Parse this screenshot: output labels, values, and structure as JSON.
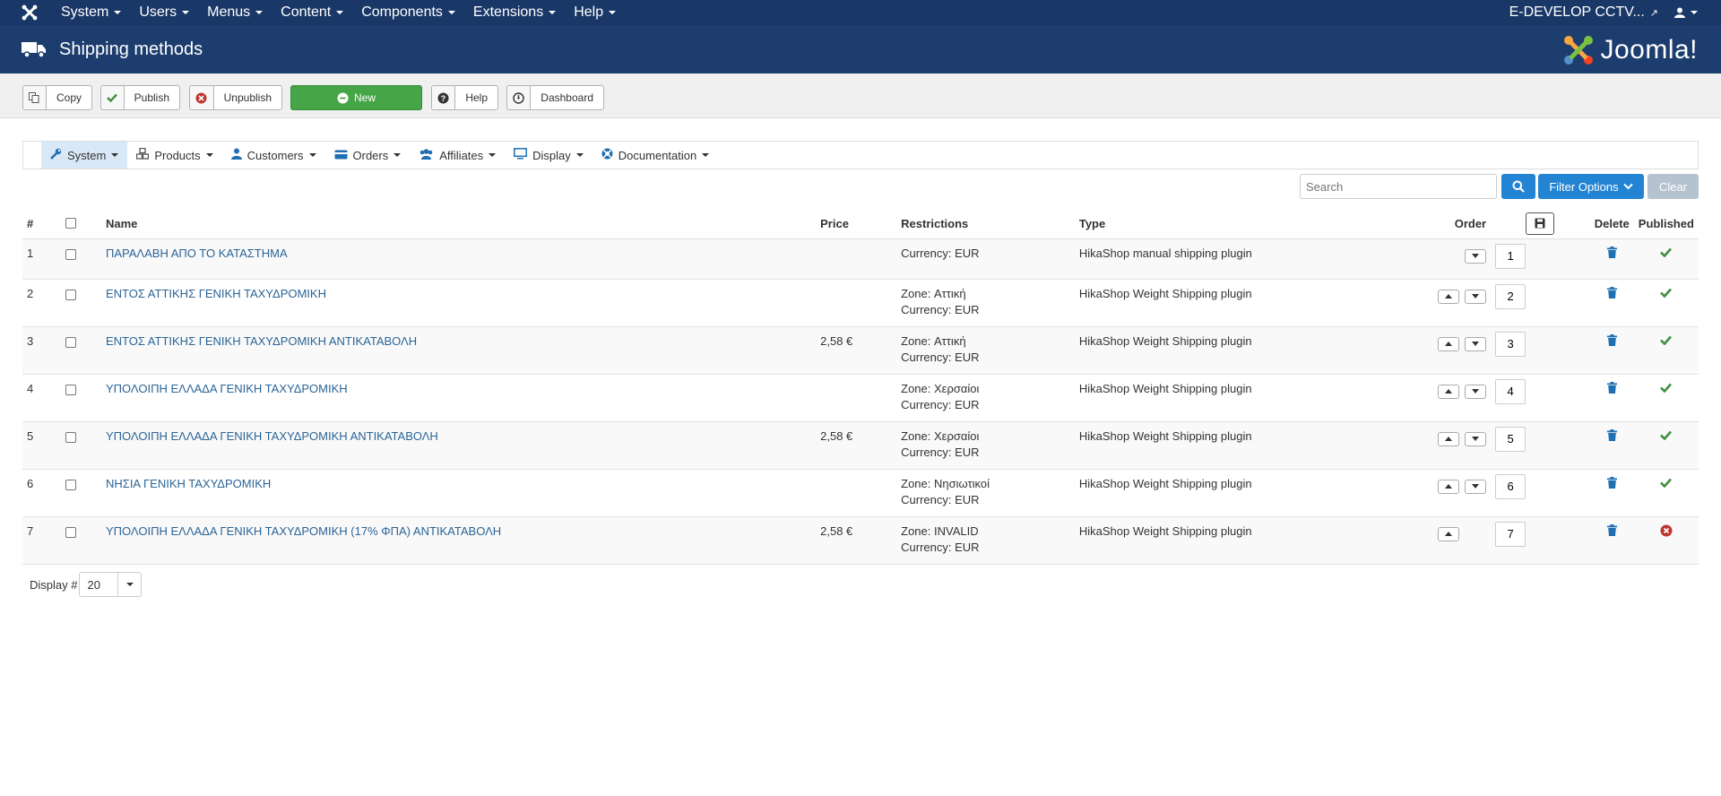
{
  "topbar": {
    "menu": [
      {
        "label": "System"
      },
      {
        "label": "Users"
      },
      {
        "label": "Menus"
      },
      {
        "label": "Content"
      },
      {
        "label": "Components"
      },
      {
        "label": "Extensions"
      },
      {
        "label": "Help"
      }
    ],
    "site_name": "E-DEVELOP CCTV..."
  },
  "header": {
    "title": "Shipping methods",
    "brand": "Joomla!"
  },
  "toolbar": {
    "copy": "Copy",
    "publish": "Publish",
    "unpublish": "Unpublish",
    "new": "New",
    "help": "Help",
    "dashboard": "Dashboard"
  },
  "submenu": [
    {
      "label": "System",
      "icon": "wrench-icon"
    },
    {
      "label": "Products",
      "icon": "cubes-icon"
    },
    {
      "label": "Customers",
      "icon": "user-icon"
    },
    {
      "label": "Orders",
      "icon": "credit-card-icon"
    },
    {
      "label": "Affiliates",
      "icon": "users-icon"
    },
    {
      "label": "Display",
      "icon": "monitor-icon"
    },
    {
      "label": "Documentation",
      "icon": "lifebuoy-icon"
    }
  ],
  "filter": {
    "search_placeholder": "Search",
    "filter_options": "Filter Options",
    "clear": "Clear"
  },
  "table": {
    "headers": {
      "num": "#",
      "name": "Name",
      "price": "Price",
      "restrictions": "Restrictions",
      "type": "Type",
      "order": "Order",
      "delete": "Delete",
      "published": "Published"
    },
    "rows": [
      {
        "num": "1",
        "name": "ΠΑΡΑΛΑΒΗ ΑΠΟ ΤΟ ΚΑΤΑΣΤΗΜΑ",
        "price": "",
        "restriction1": "Currency: EUR",
        "restriction2": "",
        "type": "HikaShop manual shipping plugin",
        "order": "1",
        "published": true
      },
      {
        "num": "2",
        "name": "ΕΝΤΟΣ ΑΤΤΙΚΗΣ ΓΕΝΙΚΗ ΤΑΧΥΔΡΟΜΙΚΗ",
        "price": "",
        "restriction1": "Zone: Αττική",
        "restriction2": "Currency: EUR",
        "type": "HikaShop Weight Shipping plugin",
        "order": "2",
        "published": true
      },
      {
        "num": "3",
        "name": "ΕΝΤΟΣ ΑΤΤΙΚΗΣ ΓΕΝΙΚΗ ΤΑΧΥΔΡΟΜΙΚΗ ΑΝΤΙΚΑΤΑΒΟΛΗ",
        "price": "2,58 €",
        "restriction1": "Zone: Αττική",
        "restriction2": "Currency: EUR",
        "type": "HikaShop Weight Shipping plugin",
        "order": "3",
        "published": true
      },
      {
        "num": "4",
        "name": "ΥΠΟΛΟΙΠΗ ΕΛΛΑΔΑ ΓΕΝΙΚΗ ΤΑΧΥΔΡΟΜΙΚΗ",
        "price": "",
        "restriction1": "Zone: Χερσαίοι",
        "restriction2": "Currency: EUR",
        "type": "HikaShop Weight Shipping plugin",
        "order": "4",
        "published": true
      },
      {
        "num": "5",
        "name": "ΥΠΟΛΟΙΠΗ ΕΛΛΑΔΑ ΓΕΝΙΚΗ ΤΑΧΥΔΡΟΜΙΚΗ ΑΝΤΙΚΑΤΑΒΟΛΗ",
        "price": "2,58 €",
        "restriction1": "Zone: Χερσαίοι",
        "restriction2": "Currency: EUR",
        "type": "HikaShop Weight Shipping plugin",
        "order": "5",
        "published": true
      },
      {
        "num": "6",
        "name": "ΝΗΣΙΑ ΓΕΝΙΚΗ ΤΑΧΥΔΡΟΜΙΚΗ",
        "price": "",
        "restriction1": "Zone: Νησιωτικοί",
        "restriction2": "Currency: EUR",
        "type": "HikaShop Weight Shipping plugin",
        "order": "6",
        "published": true
      },
      {
        "num": "7",
        "name": "ΥΠΟΛΟΙΠΗ ΕΛΛΑΔΑ ΓΕΝΙΚΗ ΤΑΧΥΔΡΟΜΙΚΗ (17% ΦΠΑ) ΑΝΤΙΚΑΤΑΒΟΛΗ",
        "price": "2,58 €",
        "restriction1": "Zone: INVALID",
        "restriction2": "Currency: EUR",
        "type": "HikaShop Weight Shipping plugin",
        "order": "7",
        "published": false
      }
    ]
  },
  "footer": {
    "display_label": "Display #",
    "display_value": "20"
  },
  "colors": {
    "navbar": "#1a3867",
    "header": "#1c3d6e",
    "link": "#2a6496",
    "new_button": "#46a546",
    "primary": "#2384d3",
    "published": "#3e8f3e",
    "unpublished": "#bd362f",
    "trash": "#1f6fb2"
  }
}
